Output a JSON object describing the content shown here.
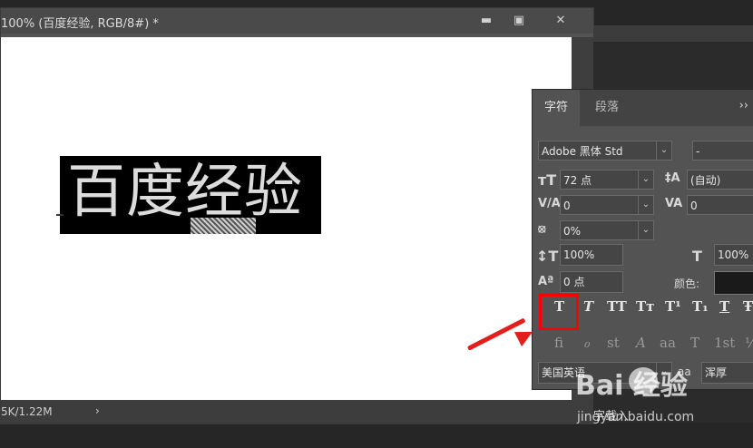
{
  "document": {
    "title": "100% (百度经验, RGB/8#) *",
    "status": "5K/1.22M",
    "status_arrow": "›",
    "minimize": "▬",
    "maximize": "▣",
    "close": "✕",
    "text_layer": "百度经验"
  },
  "panel": {
    "tabs": [
      "字符",
      "段落"
    ],
    "menu": "››",
    "font_family": "Adobe 黑体 Std",
    "font_style": "-",
    "font_size": "72 点",
    "leading": "(自动)",
    "kerning": "0",
    "tracking": "0",
    "tsume": "0%",
    "vertical_scale": "100%",
    "horizontal_scale": "100%",
    "baseline_shift": "0 点",
    "color_label": "颜色:",
    "language": "美国英语",
    "aa_label": "aa",
    "antialias": "浑厚",
    "style_buttons": [
      "T",
      "T",
      "TT",
      "Tт",
      "T¹",
      "T₁",
      "T",
      "Ŧ"
    ],
    "opentype_buttons": [
      "ﬁ",
      "ℴ",
      "st",
      "A",
      "aa",
      "T",
      "1st",
      "½"
    ]
  },
  "overlay": {
    "watermark": "Bai 经验",
    "watermark_url": "jingyan.baidu.com",
    "partial_bottom_text": "字载入"
  }
}
